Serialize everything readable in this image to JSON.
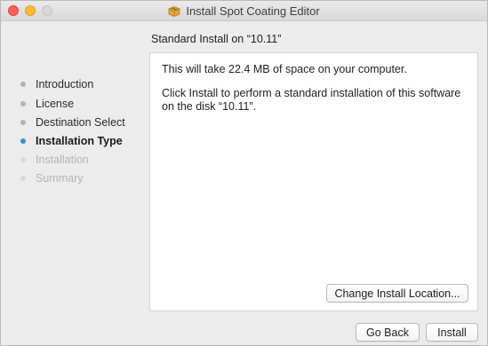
{
  "window": {
    "title": "Install Spot Coating Editor",
    "icon": "package-icon"
  },
  "sidebar": {
    "steps": [
      {
        "label": "Introduction",
        "state": "done"
      },
      {
        "label": "License",
        "state": "done"
      },
      {
        "label": "Destination Select",
        "state": "done"
      },
      {
        "label": "Installation Type",
        "state": "current"
      },
      {
        "label": "Installation",
        "state": "pending"
      },
      {
        "label": "Summary",
        "state": "pending"
      }
    ]
  },
  "main": {
    "heading": "Standard Install on “10.11”",
    "space_text": "This will take 22.4 MB of space on your computer.",
    "instruction_text": "Click Install to perform a standard installation of this software on the disk “10.11”.",
    "change_location_label": "Change Install Location..."
  },
  "footer": {
    "go_back_label": "Go Back",
    "install_label": "Install"
  },
  "colors": {
    "current_step_dot": "#3b8eea",
    "close": "#fc5f57",
    "minimize": "#fdbc2e"
  }
}
